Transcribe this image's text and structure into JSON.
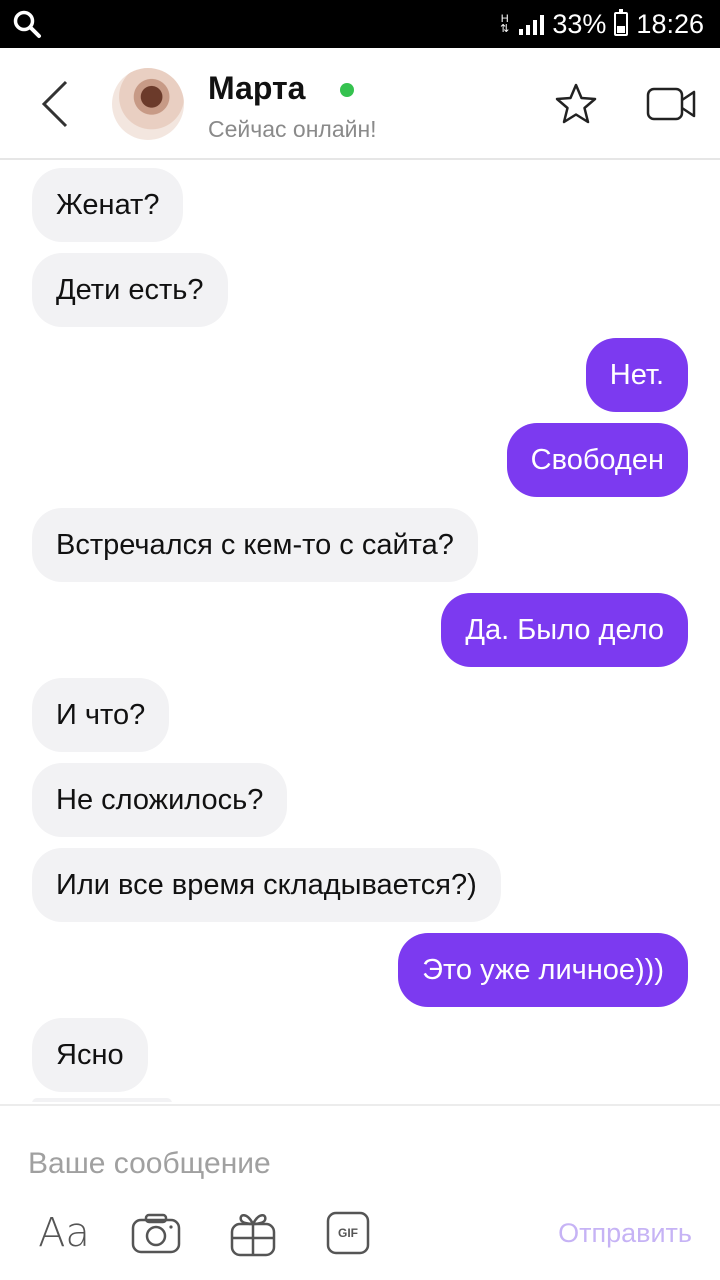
{
  "status_bar": {
    "time": "18:26",
    "battery": "33%",
    "network": "H"
  },
  "header": {
    "contact_name": "Марта",
    "contact_status": "Сейчас онлайн!",
    "online_color": "#35c24f"
  },
  "colors": {
    "accent": "#7c3af0",
    "incoming_bubble": "#f2f2f4",
    "send_disabled": "#c6b3f5"
  },
  "messages": [
    {
      "dir": "in",
      "text": "Женат?"
    },
    {
      "dir": "in",
      "text": "Дети есть?"
    },
    {
      "dir": "out",
      "text": "Нет."
    },
    {
      "dir": "out",
      "text": "Свободен"
    },
    {
      "dir": "in",
      "text": "Встречался с кем-то с сайта?"
    },
    {
      "dir": "out",
      "text": "Да. Было дело"
    },
    {
      "dir": "in",
      "text": "И что?"
    },
    {
      "dir": "in",
      "text": "Не сложилось?"
    },
    {
      "dir": "in",
      "text": "Или все время складывается?)"
    },
    {
      "dir": "out",
      "text": "Это уже личное)))"
    },
    {
      "dir": "in",
      "text": "Ясно"
    }
  ],
  "composer": {
    "placeholder": "Ваше сообщение",
    "font_button": "Aa",
    "gif_label": "GIF",
    "send_label": "Отправить"
  }
}
